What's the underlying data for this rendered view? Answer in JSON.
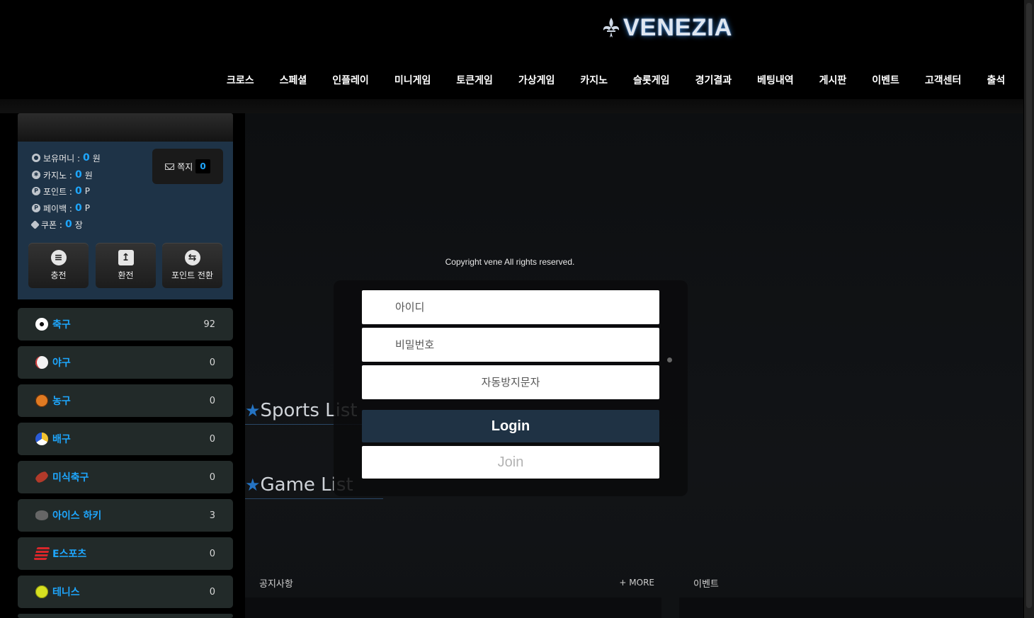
{
  "header": {
    "logo_text": "VENEZIA",
    "nav": [
      "크로스",
      "스페셜",
      "인플레이",
      "미니게임",
      "토큰게임",
      "가상게임",
      "카지노",
      "슬롯게임",
      "경기결과",
      "베팅내역",
      "게시판",
      "이벤트",
      "고객센터",
      "출석"
    ]
  },
  "account": {
    "rows": [
      {
        "label": "보유머니 :",
        "value": "0",
        "unit": "원",
        "icon": "money-icon"
      },
      {
        "label": "카지노 :",
        "value": "0",
        "unit": "원",
        "icon": "casino-chip-icon"
      },
      {
        "label": "포인트 :",
        "value": "0",
        "unit": "P",
        "icon": "point-icon"
      },
      {
        "label": "페이백 :",
        "value": "0",
        "unit": "P",
        "icon": "payback-icon"
      },
      {
        "label": "쿠폰 :",
        "value": "0",
        "unit": "장",
        "icon": "coupon-icon"
      }
    ],
    "message_label": "쪽지",
    "message_count": "0",
    "buttons": [
      {
        "label": "충전",
        "icon": "coins-icon"
      },
      {
        "label": "환전",
        "icon": "withdraw-icon"
      },
      {
        "label": "포인트 전환",
        "icon": "exchange-icon"
      }
    ]
  },
  "sports": [
    {
      "name": "축구",
      "count": "92",
      "icon": "soccer-ball-icon",
      "color": "#ffffff"
    },
    {
      "name": "야구",
      "count": "0",
      "icon": "baseball-icon",
      "color": "#f2f2f2"
    },
    {
      "name": "농구",
      "count": "0",
      "icon": "basketball-icon",
      "color": "#e07a22"
    },
    {
      "name": "배구",
      "count": "0",
      "icon": "volleyball-icon",
      "color": "#f2c230"
    },
    {
      "name": "미식축구",
      "count": "0",
      "icon": "american-football-icon",
      "color": "#b23a2a"
    },
    {
      "name": "아이스 하키",
      "count": "3",
      "icon": "hockey-puck-icon",
      "color": "#666666"
    },
    {
      "name": "E스포츠",
      "count": "0",
      "icon": "esports-icon",
      "color": "#d8262a"
    },
    {
      "name": "테니스",
      "count": "0",
      "icon": "tennis-ball-icon",
      "color": "#d7e021"
    }
  ],
  "main": {
    "copyright": "Copyright vene All rights reserved.",
    "sports_list_title": "Sports List",
    "game_list_title": "Game List",
    "notice_title": "공지사항",
    "notice_more": "+ MORE",
    "event_title": "이벤트"
  },
  "login": {
    "id_placeholder": "아이디",
    "pw_placeholder": "비밀번호",
    "captcha_placeholder": "자동방지문자",
    "login_label": "Login",
    "join_label": "Join"
  },
  "colors": {
    "accent": "#1ea7ff",
    "panel": "#1e3347",
    "login_button": "#1f3244"
  }
}
